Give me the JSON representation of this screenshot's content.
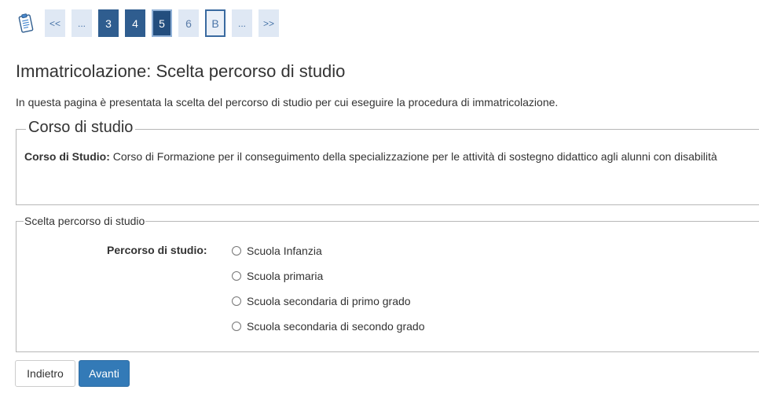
{
  "stepper": {
    "icon": "clipboard-checklist-icon",
    "first_label": "<<",
    "prev_ellipsis": "...",
    "steps": [
      {
        "label": "3",
        "state": "done"
      },
      {
        "label": "4",
        "state": "done"
      },
      {
        "label": "5",
        "state": "current"
      },
      {
        "label": "6",
        "state": "inactive"
      },
      {
        "label": "B",
        "state": "outlined"
      }
    ],
    "next_ellipsis": "...",
    "last_label": ">>"
  },
  "page": {
    "title": "Immatricolazione: Scelta percorso di studio",
    "intro": "In questa pagina è presentata la scelta del percorso di studio per cui eseguire la procedura di immatricolazione."
  },
  "course": {
    "legend": "Corso di studio",
    "label": "Corso di Studio:",
    "value": "Corso di Formazione per il conseguimento della specializzazione per le attività di sostegno didattico agli alunni con disabilità"
  },
  "path": {
    "legend": "Scelta percorso di studio",
    "label": "Percorso di studio:",
    "options": [
      {
        "label": "Scuola Infanzia",
        "selected": false
      },
      {
        "label": "Scuola primaria",
        "selected": false
      },
      {
        "label": "Scuola secondaria di primo grado",
        "selected": false
      },
      {
        "label": "Scuola secondaria di secondo grado",
        "selected": false
      }
    ]
  },
  "buttons": {
    "back_label": "Indietro",
    "next_label": "Avanti"
  },
  "colors": {
    "primary": "#337ab7",
    "step_done": "#2f5d8f",
    "step_current": "#234e7e",
    "step_inactive": "#dfe8f4"
  }
}
